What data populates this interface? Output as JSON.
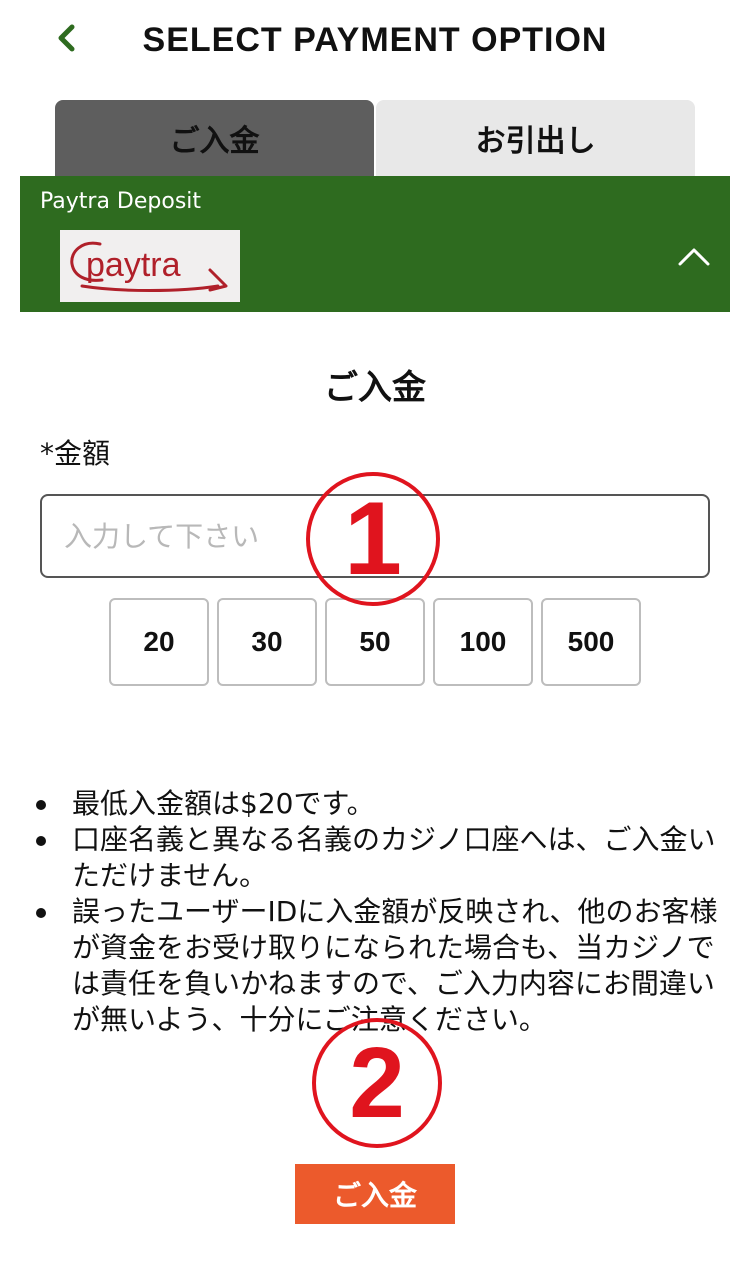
{
  "header": {
    "title": "SELECT PAYMENT OPTION"
  },
  "tabs": [
    {
      "label": "ご入金",
      "active": true
    },
    {
      "label": "お引出し",
      "active": false
    }
  ],
  "method": {
    "name": "Paytra Deposit",
    "logo_text": "paytra"
  },
  "form": {
    "section_title": "ご入金",
    "amount_label": "*金額",
    "amount_placeholder": "入力して下さい",
    "amount_value": "",
    "presets": [
      "20",
      "30",
      "50",
      "100",
      "500"
    ]
  },
  "notes": [
    "最低入金額は$20です。",
    "口座名義と異なる名義のカジノ口座へは、ご入金いただけません。",
    "誤ったユーザーIDに入金額が反映され、他のお客様が資金をお受け取りになられた場合も、当カジノでは責任を負いかねますので、ご入力内容にお間違いが無いよう、十分にご注意ください。"
  ],
  "markers": [
    "1",
    "2"
  ],
  "submit_label": "ご入金",
  "colors": {
    "panel_green": "#2e6b1f",
    "back_green": "#2e6b1f",
    "active_tab": "#5e5e5e",
    "inactive_tab": "#e8e8e8",
    "submit_orange": "#ec5a2c",
    "marker_red": "#e0141e",
    "logo_red": "#b0202a"
  },
  "icons": {
    "back": "chevron-left-icon",
    "collapse": "chevron-up-icon"
  }
}
